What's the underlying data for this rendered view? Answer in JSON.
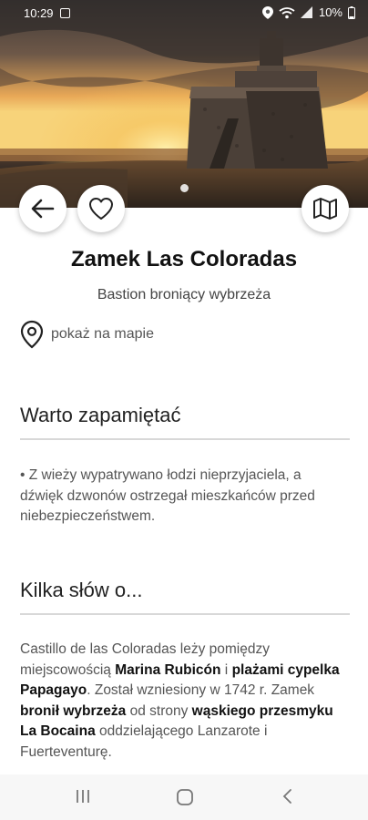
{
  "status_bar": {
    "time": "10:29",
    "battery": "10%",
    "icons": [
      "notification-icon",
      "location-icon",
      "wifi-icon",
      "signal-icon",
      "battery-icon"
    ]
  },
  "hero": {
    "image_description_icon": "castle-photo",
    "page_indicator_count": 1
  },
  "actions": {
    "back_icon": "arrow-left-icon",
    "favorite_icon": "heart-icon",
    "map_icon": "map-icon"
  },
  "place": {
    "title": "Zamek Las Coloradas",
    "subtitle": "Bastion broniący wybrzeża",
    "map_link": "pokaż na mapie"
  },
  "sections": {
    "remember": {
      "heading": "Warto zapamiętać",
      "text": "• Z wieży wypatrywano łodzi nieprzyjaciela, a dźwięk dzwonów ostrzegał mieszkańców przed niebezpieczeństwem."
    },
    "about": {
      "heading": "Kilka słów o...",
      "text_parts": [
        "Castillo de las Coloradas leży pomiędzy miejscowością ",
        "Marina Rubicón",
        " i ",
        "plażami cypelka Papagayo",
        ". Został wzniesiony w 1742 r. Zamek ",
        "bronił wybrzeża",
        " od strony ",
        "wąskiego przesmyku La Bocaina",
        " oddzielającego Lanzarote i Fuerteventurę."
      ]
    }
  },
  "colors": {
    "accent": "#111111",
    "divider": "#d8d8d8"
  }
}
